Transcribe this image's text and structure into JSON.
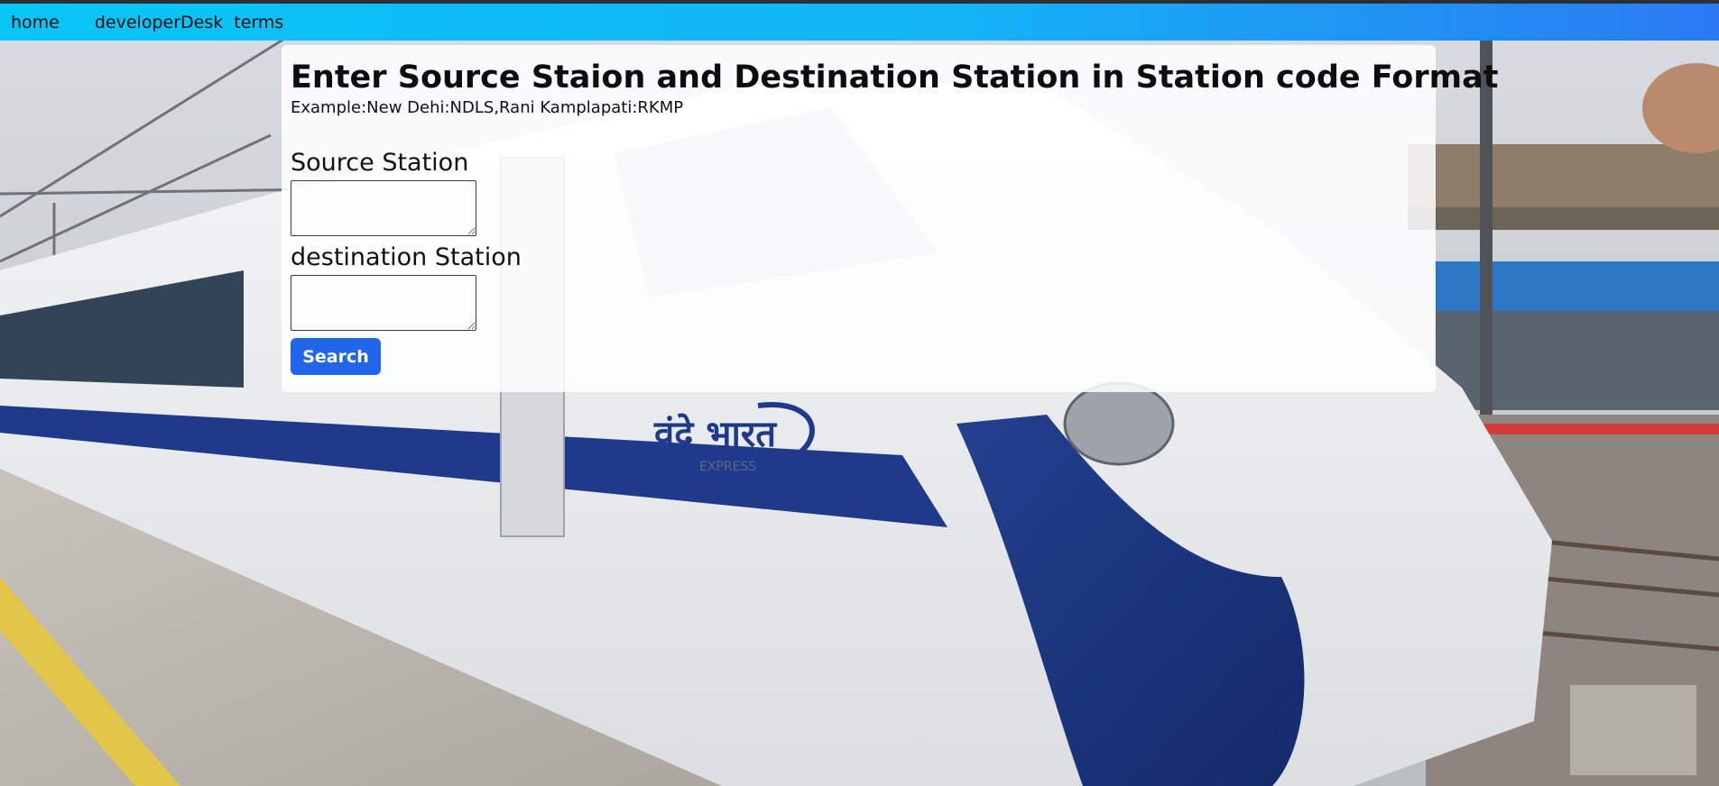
{
  "nav": {
    "items": [
      {
        "label": "home"
      },
      {
        "label": "developerDesk"
      },
      {
        "label": "terms"
      }
    ]
  },
  "form": {
    "title": "Enter Source Staion and Destination Station in Station code Format",
    "example": "Example:New Dehi:NDLS,Rani Kamplapati:RKMP",
    "source": {
      "label": "Source Station",
      "value": ""
    },
    "destination": {
      "label": "destination Station",
      "value": ""
    },
    "search_label": "Search"
  },
  "background": {
    "train_logo_text": "वंदे भारत",
    "train_logo_subtext": "EXPRESS"
  },
  "colors": {
    "nav_gradient_start": "#08c6f5",
    "nav_gradient_end": "#2b7af2",
    "button": "#2166e8",
    "train_blue": "#1f3a8a"
  }
}
